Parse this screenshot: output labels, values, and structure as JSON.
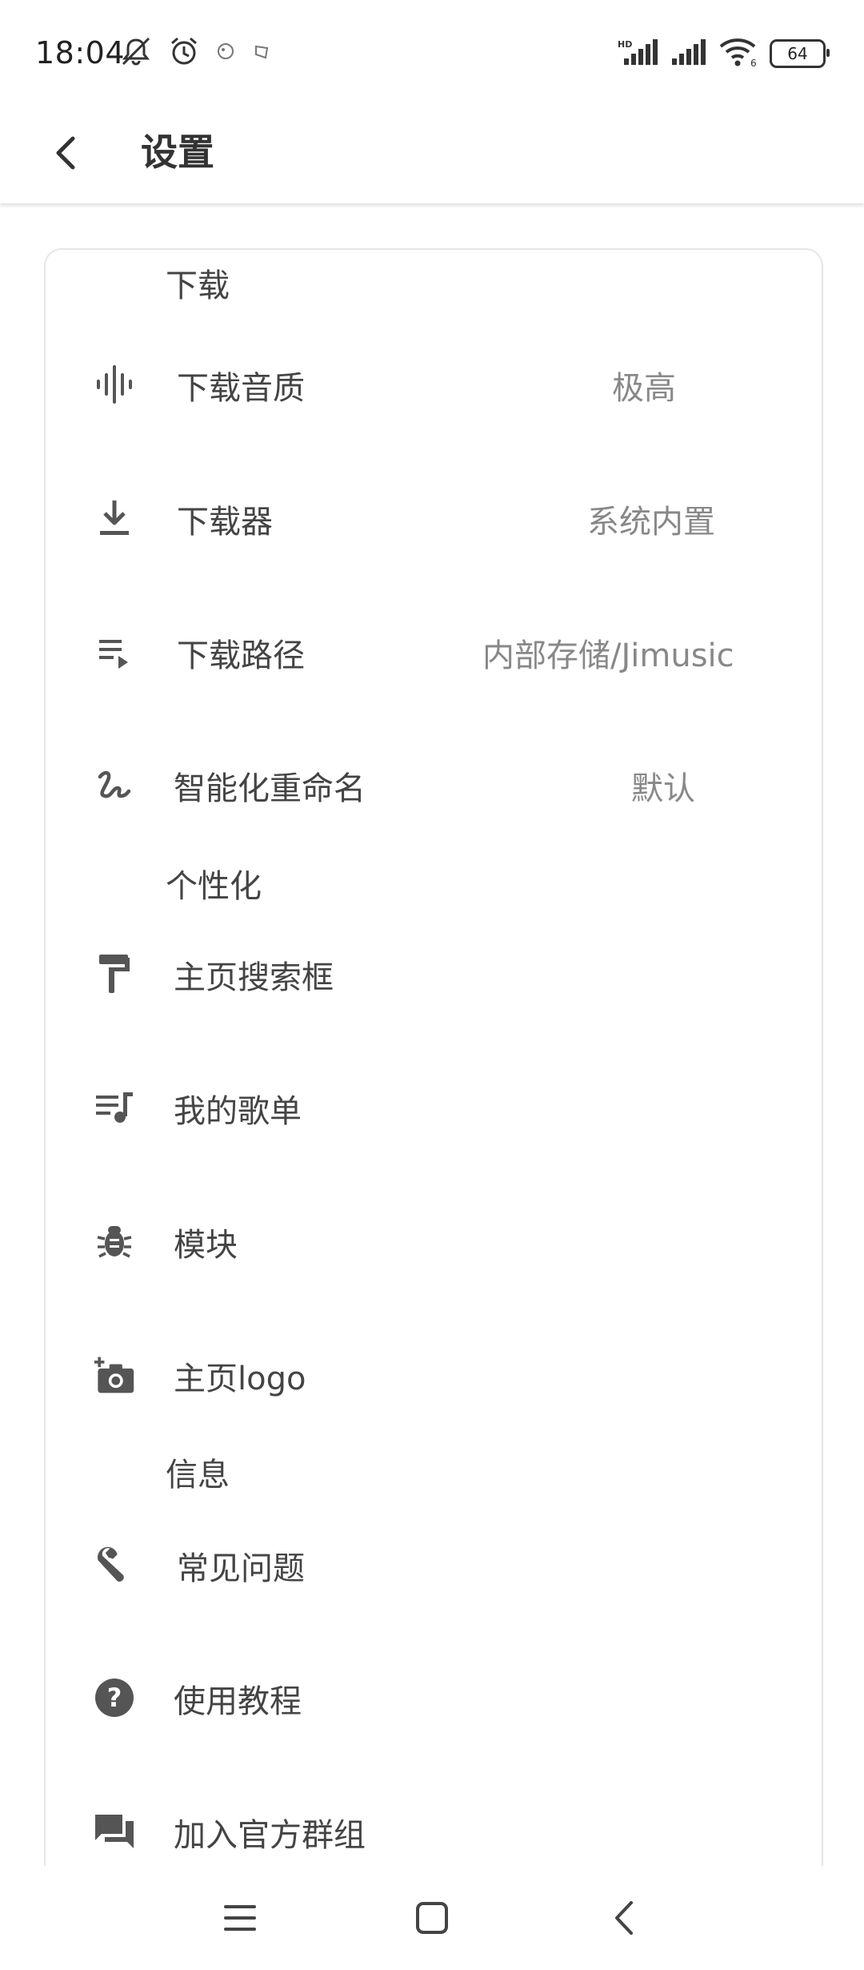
{
  "status_bar": {
    "time": "18:04",
    "battery": "64",
    "icons": [
      "mute-icon",
      "alarm-icon",
      "notification-icon",
      "notification-icon",
      "hd-signal-icon",
      "signal-icon",
      "wifi-icon",
      "battery-icon"
    ]
  },
  "app_bar": {
    "title": "设置",
    "back_icon": "chevron-left-icon"
  },
  "sections": {
    "download": {
      "title": "下载"
    },
    "personalize": {
      "title": "个性化"
    },
    "info": {
      "title": "信息"
    }
  },
  "items": {
    "download_quality": {
      "label": "下载音质",
      "value": "极高",
      "icon": "waveform-icon"
    },
    "downloader": {
      "label": "下载器",
      "value": "系统内置",
      "icon": "download-icon"
    },
    "download_path": {
      "label": "下载路径",
      "value": "内部存储/Jimusic",
      "icon": "playlist-play-icon"
    },
    "smart_rename": {
      "label": "智能化重命名",
      "value": "默认",
      "icon": "signature-icon"
    },
    "home_search": {
      "label": "主页搜索框",
      "icon": "paint-roller-icon"
    },
    "my_playlists": {
      "label": "我的歌单",
      "icon": "queue-music-icon"
    },
    "modules": {
      "label": "模块",
      "icon": "bug-icon"
    },
    "home_logo": {
      "label": "主页logo",
      "icon": "add-camera-icon"
    },
    "faq": {
      "label": "常见问题",
      "icon": "wrench-icon"
    },
    "tutorial": {
      "label": "使用教程",
      "icon": "help-circle-icon"
    },
    "join_group": {
      "label": "加入官方群组",
      "icon": "forum-icon"
    }
  },
  "nav_bar": {
    "icons": [
      "menu-icon",
      "home-square-icon",
      "back-icon"
    ]
  },
  "colors": {
    "text": "#444444",
    "secondary_text": "#888888",
    "icon": "#555555",
    "card_border": "#e6e6e6"
  }
}
